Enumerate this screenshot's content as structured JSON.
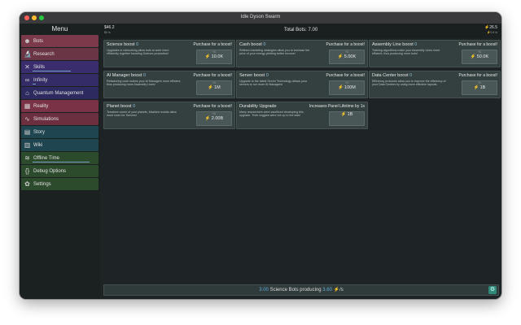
{
  "window": {
    "title": "Idle Dyson Swarm",
    "controls": {
      "close_color": "#ff5f57",
      "minimize_color": "#febc2e",
      "maximize_color": "#28c840"
    }
  },
  "sidebar": {
    "title": "Menu",
    "items": [
      {
        "label": "Bots",
        "icon": "robot-icon",
        "glyph": "☻",
        "color": "#7a3a4a"
      },
      {
        "label": "Research",
        "icon": "research-icon",
        "glyph": "🔬",
        "color": "#6a3545"
      },
      {
        "label": "Skills",
        "icon": "skills-icon",
        "glyph": "✕",
        "color": "#3a2d6e",
        "progress": 0.6
      },
      {
        "label": "Infinity",
        "icon": "infinity-icon",
        "glyph": "∞",
        "color": "#342c66",
        "progress": 0.05
      },
      {
        "label": "Quantum Management",
        "icon": "quantum-icon",
        "glyph": "⌂",
        "color": "#2d2a60"
      },
      {
        "label": "Reality",
        "icon": "reality-icon",
        "glyph": "▦",
        "color": "#7a3346"
      },
      {
        "label": "Simulations",
        "icon": "simulations-icon",
        "glyph": "∿",
        "color": "#6c2f40"
      },
      {
        "label": "Story",
        "icon": "story-icon",
        "glyph": "▤",
        "color": "#1f4550"
      },
      {
        "label": "Wiki",
        "icon": "wiki-icon",
        "glyph": "▥",
        "color": "#1f4550"
      },
      {
        "label": "Offline Time",
        "icon": "offline-time-icon",
        "glyph": "≋",
        "color": "#2c4a2c",
        "progress": 0.9
      },
      {
        "label": "Debug Options",
        "icon": "debug-icon",
        "glyph": "{}",
        "color": "#2c4a2c"
      },
      {
        "label": "Settings",
        "icon": "gear-icon",
        "glyph": "✿",
        "color": "#2c4a2c"
      }
    ]
  },
  "topbar": {
    "money": "$46.2",
    "money_rate": "$0 /s",
    "total_bots": "Total Bots: 7.00",
    "energy": "⚡26.5",
    "energy_rate": "⚡0.6 /s"
  },
  "cards": [
    {
      "title": "Science boost",
      "level": "0",
      "hint": "Purchase for a boost!",
      "desc": "Upgrades in networking allow bots to work more efficiently together boosting Science production!",
      "plus": "+1",
      "cost": "10.0K"
    },
    {
      "title": "Cash boost",
      "level": "0",
      "hint": "Purchase for a boost!",
      "desc": "Refined marketing strategies allow you to increase the price of your energy yielding better income!",
      "plus": "+1",
      "cost": "5.00K"
    },
    {
      "title": "Assembly Line boost",
      "level": "0",
      "hint": "Purchase for a boost!",
      "desc": "Training algorithms make your Assembly Lines more efficient, thus producing more bots!",
      "plus": "+1",
      "cost": "50.0K"
    },
    {
      "title": "AI Manager boost",
      "level": "0",
      "hint": "Purchase for a boost!",
      "desc": "Refactoring code makes your AI Managers more efficient, thus producing more Assembly Lines!",
      "plus": "+1",
      "cost": "1M"
    },
    {
      "title": "Server boost",
      "level": "0",
      "hint": "Purchase for a boost!",
      "desc": "Upgrade to the latest Server Technology allows your servers to run more AI Managers!",
      "plus": "+1",
      "cost": "100M"
    },
    {
      "title": "Data Center boost",
      "level": "0",
      "hint": "Purchase for a boost!",
      "desc": "Efficiency protocols allow you to improve the efficiency of your Data Centers by using more effective layouts.",
      "plus": "+1",
      "cost": "1B"
    },
    {
      "title": "Planet boost",
      "level": "0",
      "hint": "Purchase for a boost!",
      "desc": "Terraform some of your planets, Machine worlds allow more room for Servers!",
      "plus": "+1",
      "cost": "2.00B"
    },
    {
      "title": "Durability Upgrade",
      "level": "",
      "hint": "Increases Panel Lifetime by 1s",
      "desc": "Many researchers were sacrificed developing this upgrade. Their veggies were not up to the task!",
      "plus": "",
      "cost": "1B"
    }
  ],
  "bottombar": {
    "count": "3.00",
    "label": "Science Bots producing",
    "rate": "3.60",
    "unit": "⚡/s"
  }
}
